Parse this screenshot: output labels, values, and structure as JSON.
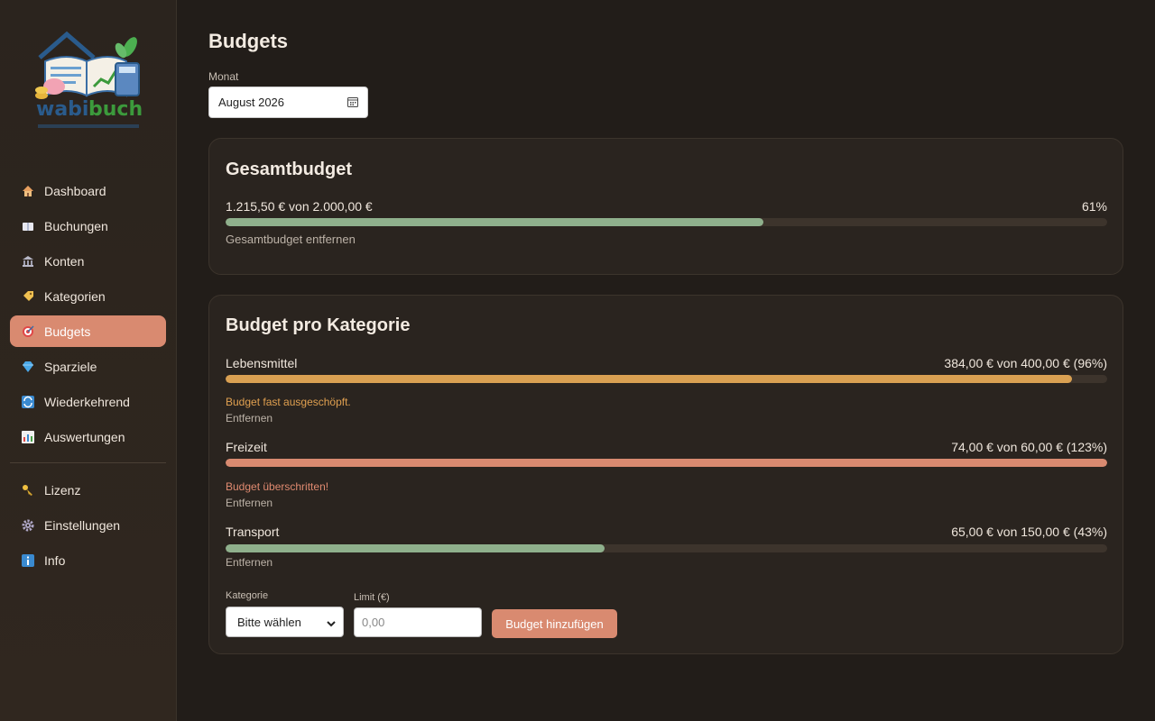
{
  "brand": {
    "logo_text_a": "wabi",
    "logo_text_b": "buch"
  },
  "sidebar": {
    "items": [
      {
        "label": "Dashboard",
        "icon": "house-icon"
      },
      {
        "label": "Buchungen",
        "icon": "book-icon"
      },
      {
        "label": "Konten",
        "icon": "bank-icon"
      },
      {
        "label": "Kategorien",
        "icon": "tag-icon"
      },
      {
        "label": "Budgets",
        "icon": "target-icon",
        "active": true
      },
      {
        "label": "Sparziele",
        "icon": "gem-icon"
      },
      {
        "label": "Wiederkehrend",
        "icon": "repeat-icon"
      },
      {
        "label": "Auswertungen",
        "icon": "chart-icon"
      }
    ],
    "items_bottom": [
      {
        "label": "Lizenz",
        "icon": "key-icon"
      },
      {
        "label": "Einstellungen",
        "icon": "gear-icon"
      },
      {
        "label": "Info",
        "icon": "info-icon"
      }
    ]
  },
  "page": {
    "title": "Budgets",
    "month_label": "Monat",
    "month_value": "August 2026"
  },
  "total": {
    "title": "Gesamtbudget",
    "summary": "1.215,50 € von 2.000,00 €",
    "percent_label": "61%",
    "progress": 0.61,
    "remove_label": "Gesamtbudget entfernen"
  },
  "categories": {
    "title": "Budget pro Kategorie",
    "items": [
      {
        "name": "Lebensmittel",
        "summary": "384,00 € von 400,00 € (96%)",
        "progress": 0.96,
        "warning": "Budget fast ausgeschöpft.",
        "remove": "Entfernen"
      },
      {
        "name": "Freizeit",
        "summary": "74,00 € von 60,00 € (123%)",
        "progress": 1.0,
        "warning": "Budget überschritten!",
        "remove": "Entfernen"
      },
      {
        "name": "Transport",
        "summary": "65,00 € von 150,00 € (43%)",
        "progress": 0.43,
        "warning": "",
        "remove": "Entfernen"
      }
    ]
  },
  "form": {
    "category_label": "Kategorie",
    "category_value": "Bitte wählen",
    "limit_label": "Limit (€)",
    "limit_placeholder": "0,00",
    "submit_label": "Budget hinzufügen"
  },
  "colors": {
    "accent": "#d98a70",
    "progress_ok": "#8fb08c",
    "progress_warn": "#d9a052",
    "progress_over": "#d98a70",
    "text_warn": "#e0a050",
    "text_over": "#e08a70"
  }
}
